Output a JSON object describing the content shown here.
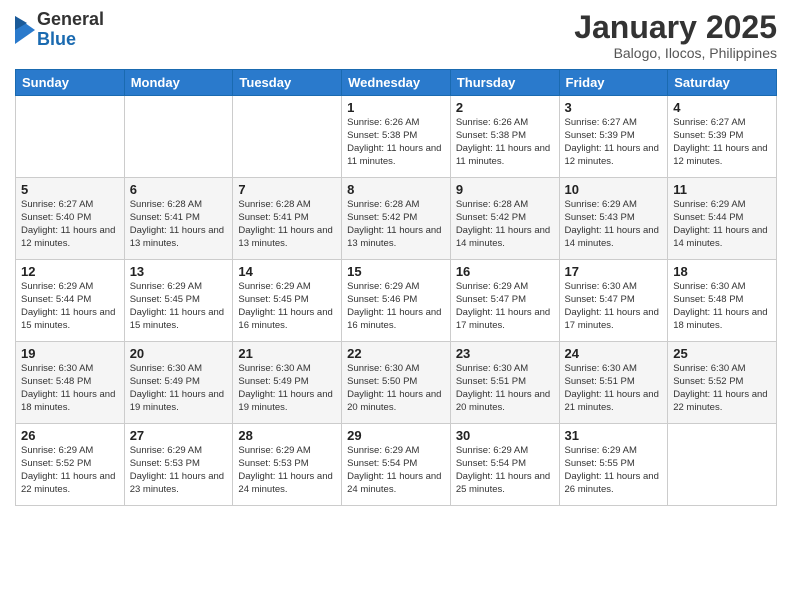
{
  "header": {
    "logo_general": "General",
    "logo_blue": "Blue",
    "month_title": "January 2025",
    "location": "Balogo, Ilocos, Philippines"
  },
  "weekdays": [
    "Sunday",
    "Monday",
    "Tuesday",
    "Wednesday",
    "Thursday",
    "Friday",
    "Saturday"
  ],
  "weeks": [
    [
      {
        "day": "",
        "sunrise": "",
        "sunset": "",
        "daylight": ""
      },
      {
        "day": "",
        "sunrise": "",
        "sunset": "",
        "daylight": ""
      },
      {
        "day": "",
        "sunrise": "",
        "sunset": "",
        "daylight": ""
      },
      {
        "day": "1",
        "sunrise": "Sunrise: 6:26 AM",
        "sunset": "Sunset: 5:38 PM",
        "daylight": "Daylight: 11 hours and 11 minutes."
      },
      {
        "day": "2",
        "sunrise": "Sunrise: 6:26 AM",
        "sunset": "Sunset: 5:38 PM",
        "daylight": "Daylight: 11 hours and 11 minutes."
      },
      {
        "day": "3",
        "sunrise": "Sunrise: 6:27 AM",
        "sunset": "Sunset: 5:39 PM",
        "daylight": "Daylight: 11 hours and 12 minutes."
      },
      {
        "day": "4",
        "sunrise": "Sunrise: 6:27 AM",
        "sunset": "Sunset: 5:39 PM",
        "daylight": "Daylight: 11 hours and 12 minutes."
      }
    ],
    [
      {
        "day": "5",
        "sunrise": "Sunrise: 6:27 AM",
        "sunset": "Sunset: 5:40 PM",
        "daylight": "Daylight: 11 hours and 12 minutes."
      },
      {
        "day": "6",
        "sunrise": "Sunrise: 6:28 AM",
        "sunset": "Sunset: 5:41 PM",
        "daylight": "Daylight: 11 hours and 13 minutes."
      },
      {
        "day": "7",
        "sunrise": "Sunrise: 6:28 AM",
        "sunset": "Sunset: 5:41 PM",
        "daylight": "Daylight: 11 hours and 13 minutes."
      },
      {
        "day": "8",
        "sunrise": "Sunrise: 6:28 AM",
        "sunset": "Sunset: 5:42 PM",
        "daylight": "Daylight: 11 hours and 13 minutes."
      },
      {
        "day": "9",
        "sunrise": "Sunrise: 6:28 AM",
        "sunset": "Sunset: 5:42 PM",
        "daylight": "Daylight: 11 hours and 14 minutes."
      },
      {
        "day": "10",
        "sunrise": "Sunrise: 6:29 AM",
        "sunset": "Sunset: 5:43 PM",
        "daylight": "Daylight: 11 hours and 14 minutes."
      },
      {
        "day": "11",
        "sunrise": "Sunrise: 6:29 AM",
        "sunset": "Sunset: 5:44 PM",
        "daylight": "Daylight: 11 hours and 14 minutes."
      }
    ],
    [
      {
        "day": "12",
        "sunrise": "Sunrise: 6:29 AM",
        "sunset": "Sunset: 5:44 PM",
        "daylight": "Daylight: 11 hours and 15 minutes."
      },
      {
        "day": "13",
        "sunrise": "Sunrise: 6:29 AM",
        "sunset": "Sunset: 5:45 PM",
        "daylight": "Daylight: 11 hours and 15 minutes."
      },
      {
        "day": "14",
        "sunrise": "Sunrise: 6:29 AM",
        "sunset": "Sunset: 5:45 PM",
        "daylight": "Daylight: 11 hours and 16 minutes."
      },
      {
        "day": "15",
        "sunrise": "Sunrise: 6:29 AM",
        "sunset": "Sunset: 5:46 PM",
        "daylight": "Daylight: 11 hours and 16 minutes."
      },
      {
        "day": "16",
        "sunrise": "Sunrise: 6:29 AM",
        "sunset": "Sunset: 5:47 PM",
        "daylight": "Daylight: 11 hours and 17 minutes."
      },
      {
        "day": "17",
        "sunrise": "Sunrise: 6:30 AM",
        "sunset": "Sunset: 5:47 PM",
        "daylight": "Daylight: 11 hours and 17 minutes."
      },
      {
        "day": "18",
        "sunrise": "Sunrise: 6:30 AM",
        "sunset": "Sunset: 5:48 PM",
        "daylight": "Daylight: 11 hours and 18 minutes."
      }
    ],
    [
      {
        "day": "19",
        "sunrise": "Sunrise: 6:30 AM",
        "sunset": "Sunset: 5:48 PM",
        "daylight": "Daylight: 11 hours and 18 minutes."
      },
      {
        "day": "20",
        "sunrise": "Sunrise: 6:30 AM",
        "sunset": "Sunset: 5:49 PM",
        "daylight": "Daylight: 11 hours and 19 minutes."
      },
      {
        "day": "21",
        "sunrise": "Sunrise: 6:30 AM",
        "sunset": "Sunset: 5:49 PM",
        "daylight": "Daylight: 11 hours and 19 minutes."
      },
      {
        "day": "22",
        "sunrise": "Sunrise: 6:30 AM",
        "sunset": "Sunset: 5:50 PM",
        "daylight": "Daylight: 11 hours and 20 minutes."
      },
      {
        "day": "23",
        "sunrise": "Sunrise: 6:30 AM",
        "sunset": "Sunset: 5:51 PM",
        "daylight": "Daylight: 11 hours and 20 minutes."
      },
      {
        "day": "24",
        "sunrise": "Sunrise: 6:30 AM",
        "sunset": "Sunset: 5:51 PM",
        "daylight": "Daylight: 11 hours and 21 minutes."
      },
      {
        "day": "25",
        "sunrise": "Sunrise: 6:30 AM",
        "sunset": "Sunset: 5:52 PM",
        "daylight": "Daylight: 11 hours and 22 minutes."
      }
    ],
    [
      {
        "day": "26",
        "sunrise": "Sunrise: 6:29 AM",
        "sunset": "Sunset: 5:52 PM",
        "daylight": "Daylight: 11 hours and 22 minutes."
      },
      {
        "day": "27",
        "sunrise": "Sunrise: 6:29 AM",
        "sunset": "Sunset: 5:53 PM",
        "daylight": "Daylight: 11 hours and 23 minutes."
      },
      {
        "day": "28",
        "sunrise": "Sunrise: 6:29 AM",
        "sunset": "Sunset: 5:53 PM",
        "daylight": "Daylight: 11 hours and 24 minutes."
      },
      {
        "day": "29",
        "sunrise": "Sunrise: 6:29 AM",
        "sunset": "Sunset: 5:54 PM",
        "daylight": "Daylight: 11 hours and 24 minutes."
      },
      {
        "day": "30",
        "sunrise": "Sunrise: 6:29 AM",
        "sunset": "Sunset: 5:54 PM",
        "daylight": "Daylight: 11 hours and 25 minutes."
      },
      {
        "day": "31",
        "sunrise": "Sunrise: 6:29 AM",
        "sunset": "Sunset: 5:55 PM",
        "daylight": "Daylight: 11 hours and 26 minutes."
      },
      {
        "day": "",
        "sunrise": "",
        "sunset": "",
        "daylight": ""
      }
    ]
  ]
}
